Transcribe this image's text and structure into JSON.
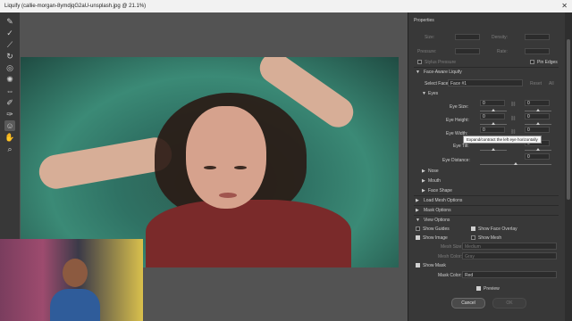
{
  "window": {
    "title": "Liquify (callie-morgan-8ymdjqG2aU-unsplash.jpg @ 21.1%)"
  },
  "panel": {
    "title": "Properties",
    "brush": {
      "size": "Size:",
      "density": "Density:",
      "pressure": "Pressure:",
      "rate": "Rate:",
      "stylus": "Stylus Pressure",
      "pin_edges": "Pin Edges"
    },
    "face_aware": {
      "header": "Face-Aware Liquify",
      "select_face_label": "Select Face:",
      "select_face_value": "Face #1",
      "reset": "Reset",
      "all": "All"
    },
    "eyes": {
      "header": "Eyes",
      "eye_size": "Eye Size:",
      "eye_height": "Eye Height:",
      "eye_width": "Eye Width:",
      "eye_tilt": "Eye Tilt:",
      "eye_distance": "Eye Distance:",
      "val_size_l": "0",
      "val_size_r": "0",
      "val_height_l": "0",
      "val_height_r": "0",
      "val_width_l": "0",
      "val_width_r": "0",
      "val_tilt_r": "0",
      "val_distance": "0"
    },
    "subsections": [
      "Nose",
      "Mouth",
      "Face Shape"
    ],
    "load_mesh": "Load Mesh Options",
    "mask_options": "Mask Options",
    "view_options": "View Options",
    "show_guides": "Show Guides",
    "show_face_overlay": "Show Face Overlay",
    "show_image": "Show Image",
    "show_mesh": "Show Mesh",
    "mesh_size_label": "Mesh Size:",
    "mesh_size_value": "Medium",
    "mesh_color_label": "Mesh Color:",
    "mesh_color_value": "Gray",
    "show_mask": "Show Mask",
    "mask_color_label": "Mask Color:",
    "mask_color_value": "Red",
    "preview": "Preview",
    "cancel": "Cancel",
    "ok": "OK"
  },
  "tooltip": "Expand/contract the left eye horizontally"
}
